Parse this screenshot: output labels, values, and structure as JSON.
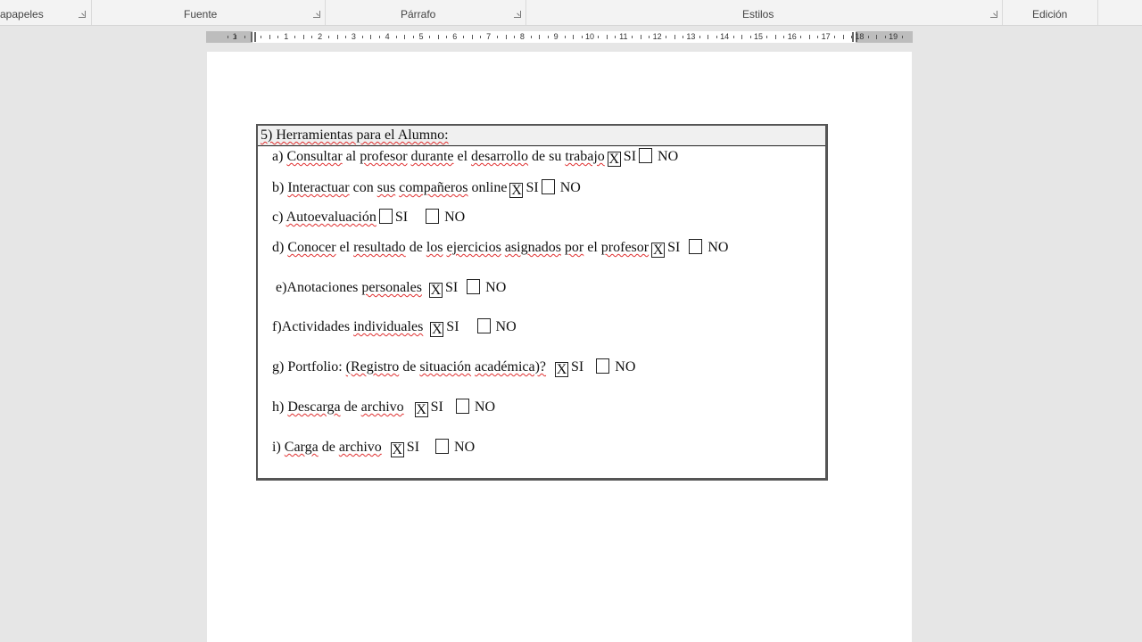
{
  "ribbon": {
    "groups": [
      {
        "label": "apapeles"
      },
      {
        "label": "Fuente"
      },
      {
        "label": "Párrafo"
      },
      {
        "label": "Estilos"
      },
      {
        "label": "Edición"
      }
    ]
  },
  "ruler": {
    "numbers": [
      "1",
      "1",
      "2",
      "3",
      "4",
      "5",
      "6",
      "7",
      "8",
      "9",
      "10",
      "11",
      "12",
      "13",
      "14",
      "15",
      "16",
      "17",
      "18",
      "19"
    ]
  },
  "document": {
    "section_title": "5) Herramientas para el Alumno:",
    "items": [
      {
        "label": "a) Consultar al profesor durante el desarrollo de su trabajo",
        "si_mark": "X",
        "si": "SI",
        "no_mark": "",
        "no": "NO"
      },
      {
        "label": "b) Interactuar con sus compañeros online",
        "si_mark": "X",
        "si": "SI",
        "no_mark": "",
        "no": "NO"
      },
      {
        "label": "c) Autoevaluación",
        "si_mark": "",
        "si": "SI",
        "no_mark": "",
        "no": "NO"
      },
      {
        "label": "d) Conocer el resultado de los ejercicios asignados por el profesor",
        "si_mark": "X",
        "si": "SI",
        "no_mark": "",
        "no": "NO"
      },
      {
        "label": "e)Anotaciones personales",
        "si_mark": "X",
        "si": "SI",
        "no_mark": "",
        "no": "NO"
      },
      {
        "label": "f)Actividades individuales",
        "si_mark": "X",
        "si": "SI",
        "no_mark": "",
        "no": "NO"
      },
      {
        "label": "g) Portfolio: (Registro de situación académica)?",
        "si_mark": "X",
        "si": "SI",
        "no_mark": "",
        "no": "NO"
      },
      {
        "label": "h) Descarga de archivo",
        "si_mark": "X",
        "si": "SI",
        "no_mark": "",
        "no": "NO"
      },
      {
        "label": "i) Carga de archivo",
        "si_mark": "X",
        "si": "SI",
        "no_mark": "",
        "no": "NO"
      }
    ]
  }
}
